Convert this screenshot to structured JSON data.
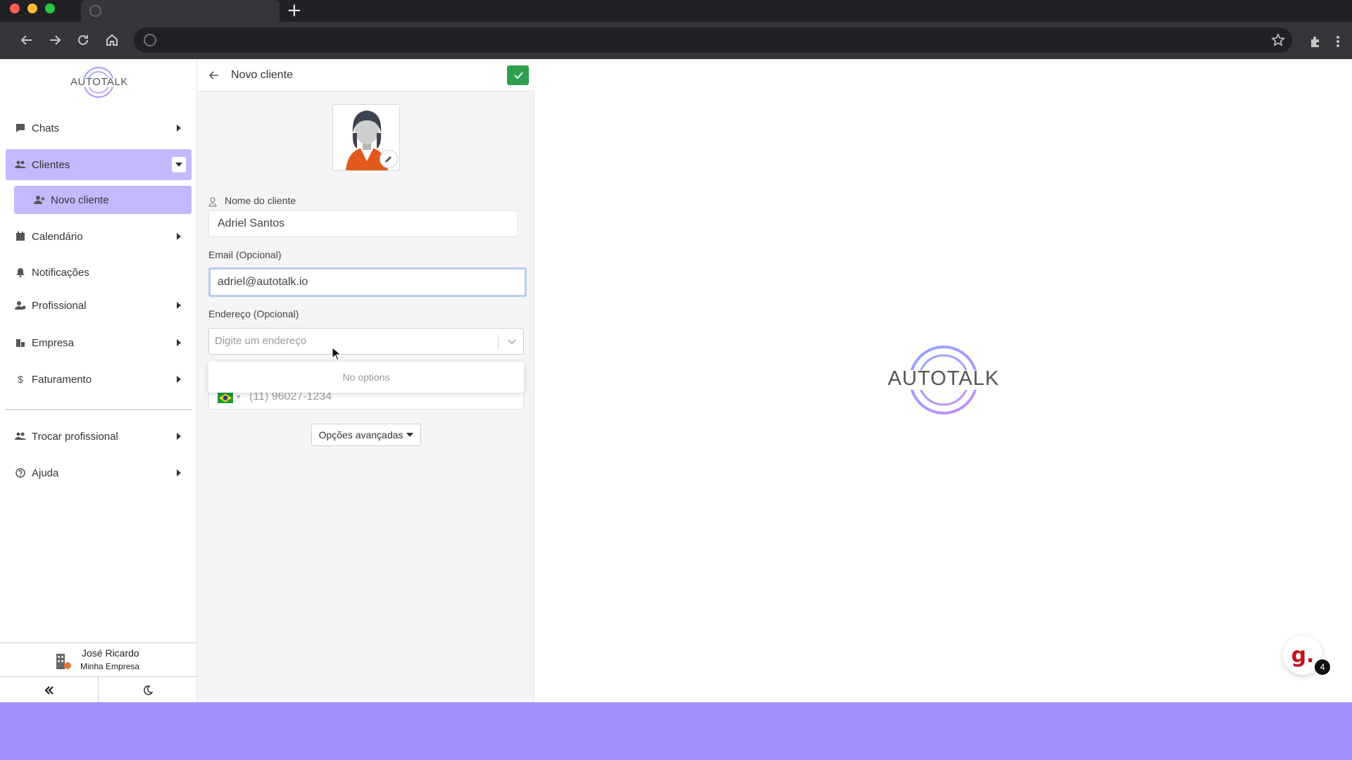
{
  "browser": {
    "new_tab_glyph": "+"
  },
  "app": {
    "logo_text": "AUTOTALK",
    "accent_color": "#c4b8ff",
    "footer_color": "#a090fb"
  },
  "sidebar": {
    "items": [
      {
        "label": "Chats",
        "icon": "chat-icon"
      },
      {
        "label": "Clientes",
        "icon": "users-icon"
      },
      {
        "label": "Calendário",
        "icon": "calendar-icon"
      },
      {
        "label": "Notificações",
        "icon": "bell-icon"
      },
      {
        "label": "Profissional",
        "icon": "professional-icon"
      },
      {
        "label": "Empresa",
        "icon": "building-icon"
      },
      {
        "label": "Faturamento",
        "icon": "dollar-icon"
      },
      {
        "label": "Trocar profissional",
        "icon": "switch-users-icon"
      },
      {
        "label": "Ajuda",
        "icon": "help-icon"
      }
    ],
    "sub_item": {
      "label": "Novo cliente",
      "icon": "user-plus-icon"
    },
    "user": {
      "name": "José Ricardo",
      "company": "Minha Empresa"
    }
  },
  "form": {
    "title": "Novo cliente",
    "name_label": "Nome do cliente",
    "name_value": "Adriel Santos",
    "email_label": "Email (Opcional)",
    "email_value": "adriel@autotalk.io",
    "address_label": "Endereço (Opcional)",
    "address_placeholder": "Digite um endereço",
    "dropdown_empty": "No options",
    "phone_value": "(11) 96027-1234",
    "advanced_label": "Opções avançadas"
  },
  "chat_widget": {
    "glyph": "g.",
    "badge_count": "4"
  }
}
